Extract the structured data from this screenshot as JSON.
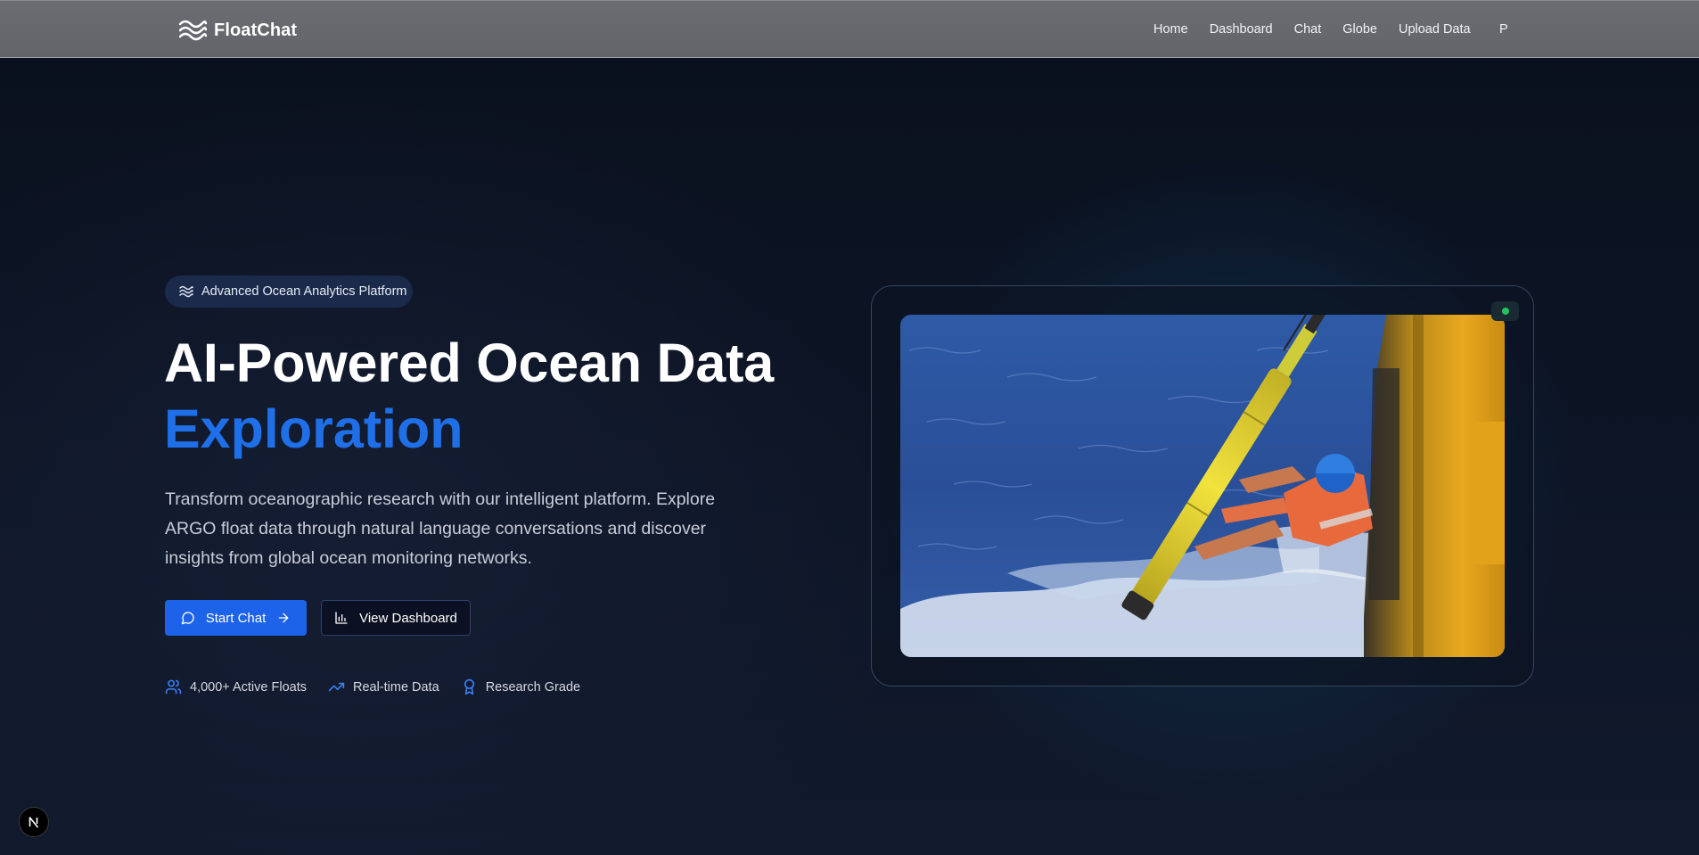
{
  "nav": {
    "brand": "FloatChat",
    "links": [
      "Home",
      "Dashboard",
      "Chat",
      "Globe",
      "Upload Data"
    ],
    "user_initial": "P"
  },
  "hero": {
    "badge": "Advanced Ocean Analytics Platform",
    "title_line1": "AI-Powered Ocean Data",
    "title_line2": "Exploration",
    "lead": "Transform oceanographic research with our intelligent platform. Explore ARGO float data through natural language conversations and discover insights from global ocean monitoring networks.",
    "primary_button": "Start Chat",
    "secondary_button": "View Dashboard",
    "stats": [
      {
        "icon": "users-icon",
        "label": "4,000+ Active Floats"
      },
      {
        "icon": "trending-up-icon",
        "label": "Real-time Data"
      },
      {
        "icon": "award-icon",
        "label": "Research Grade"
      }
    ]
  },
  "colors": {
    "accent": "#1d63e9",
    "title_accent": "#1f6fe8",
    "status": "#22c55e"
  }
}
